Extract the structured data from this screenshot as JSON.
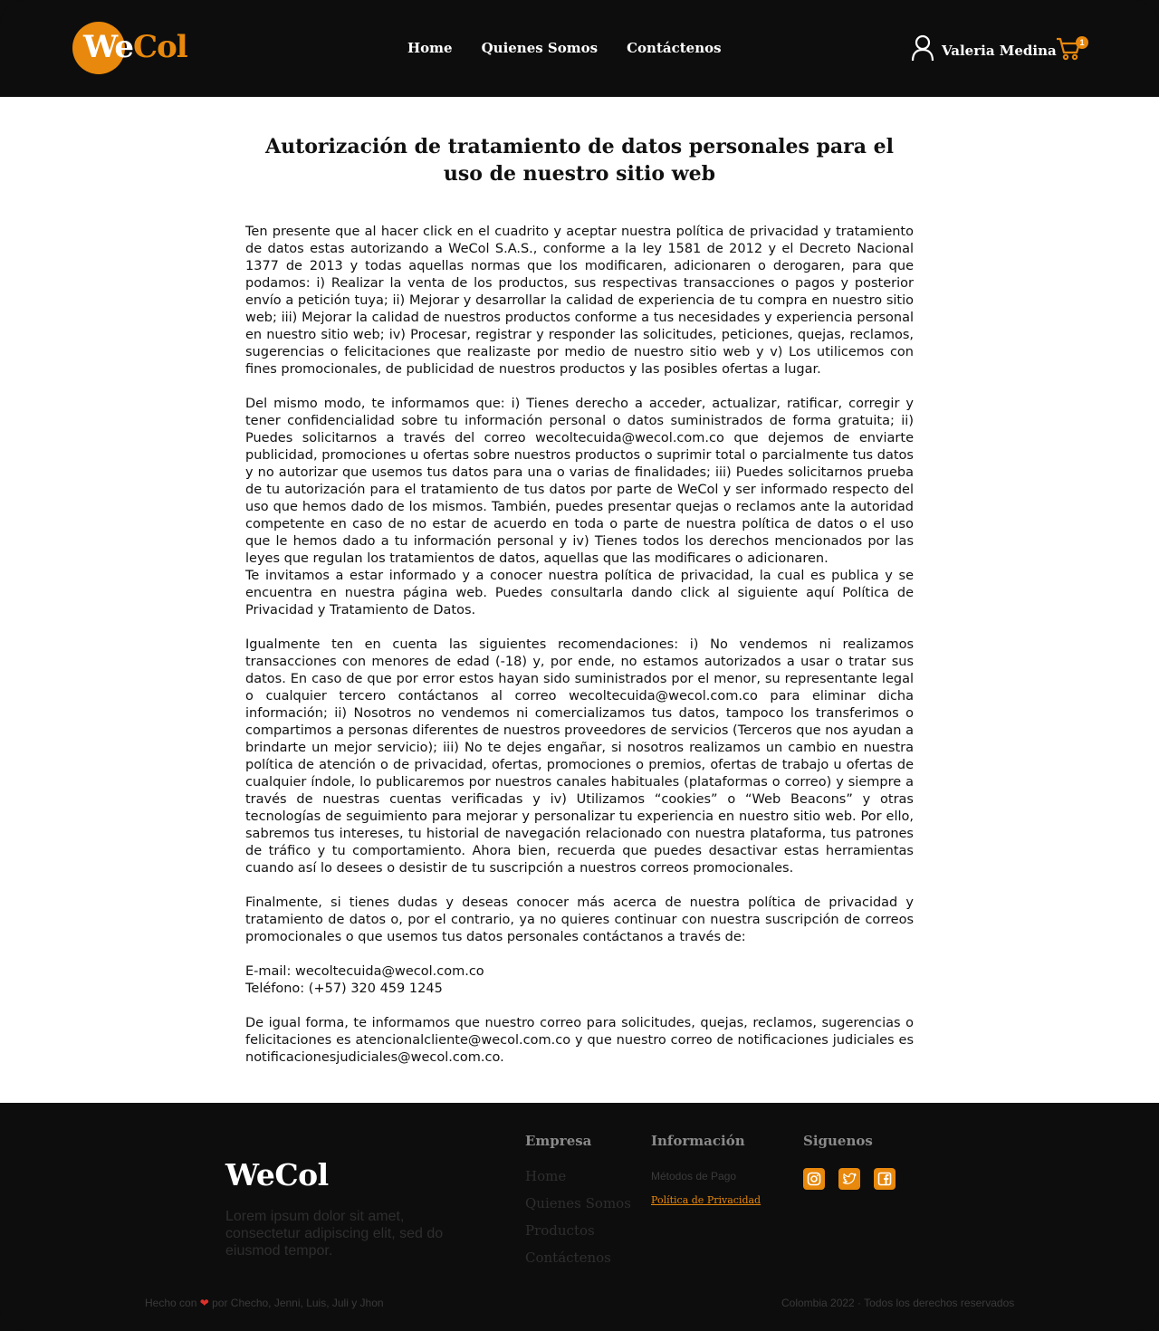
{
  "brand": {
    "logo_we": "We",
    "logo_col": "Col",
    "accent_color": "#e8880c"
  },
  "nav": {
    "items": [
      "Home",
      "Quienes Somos",
      "Contáctenos"
    ]
  },
  "user": {
    "name": "Valeria Medina",
    "user_icon": "user-icon",
    "cart_icon": "cart-icon",
    "cart_count": "1"
  },
  "main": {
    "title": "Autorización de tratamiento de datos personales para el uso de nuestro sitio web",
    "p1": "Ten presente que al hacer click en el cuadrito y aceptar nuestra política de privacidad y tratamiento de datos estas autorizando a WeCol S.A.S., conforme a la ley 1581 de 2012 y el Decreto Nacional 1377 de 2013 y todas aquellas normas que los modificaren, adicionaren o derogaren, para que podamos: i) Realizar la venta de los productos, sus respectivas transacciones o pagos y posterior envío a petición tuya; ii) Mejorar y desarrollar la calidad de experiencia de tu compra en nuestro sitio web; iii) Mejorar la calidad de nuestros productos conforme a tus necesidades y experiencia personal en nuestro sitio web; iv) Procesar, registrar y responder las solicitudes, peticiones, quejas, reclamos, sugerencias o felicitaciones que realizaste por medio de nuestro sitio web y v) Los utilicemos con fines promocionales, de publicidad de nuestros productos y las posibles ofertas a lugar.",
    "p2": "Del mismo modo, te informamos que: i) Tienes derecho a acceder, actualizar, ratificar, corregir y tener confidencialidad sobre tu información personal o datos suministrados de forma gratuita; ii) Puedes solicitarnos a través del correo wecoltecuida@wecol.com.co que dejemos de enviarte publicidad, promociones u ofertas sobre nuestros productos o suprimir total o parcialmente tus datos y no autorizar que usemos tus datos para una o varias de finalidades; iii) Puedes solicitarnos prueba de tu autorización para el tratamiento de tus datos por parte de WeCol y ser informado respecto del uso que hemos dado de los mismos. También, puedes presentar quejas o reclamos ante la autoridad competente en caso de no estar de acuerdo en toda o parte de nuestra política de datos o el uso que le hemos dado a tu información personal y iv) Tienes todos los derechos mencionados por las leyes que regulan los tratamientos de datos, aquellas que las modificares o adicionaren.",
    "p3": "Te invitamos a estar informado y a conocer nuestra política de privacidad, la cual es publica y se encuentra en nuestra página web. Puedes consultarla dando click al siguiente aquí Política de Privacidad y Tratamiento de Datos.",
    "p4": "Igualmente ten en cuenta las siguientes recomendaciones: i) No vendemos ni realizamos transacciones con menores de edad (-18) y, por ende, no estamos autorizados a usar o tratar sus datos. En caso de que por error estos hayan sido suministrados por el menor, su representante legal o cualquier tercero contáctanos al correo wecoltecuida@wecol.com.co para eliminar dicha información; ii) Nosotros no vendemos ni comercializamos tus datos, tampoco los transferimos o compartimos a personas diferentes de nuestros proveedores de servicios (Terceros que nos ayudan a brindarte un mejor servicio); iii) No te dejes engañar, si nosotros realizamos un cambio en nuestra política de atención o de privacidad, ofertas, promociones o premios, ofertas de trabajo u ofertas de cualquier índole, lo publicaremos por nuestros canales habituales (plataformas o correo) y siempre a través de nuestras cuentas verificadas y iv) Utilizamos “cookies” o “Web Beacons” y otras tecnologías de seguimiento para mejorar y personalizar tu experiencia en nuestro sitio web. Por ello, sabremos tus intereses, tu historial de navegación relacionado con nuestra plataforma, tus patrones de tráfico y tu comportamiento. Ahora bien, recuerda que puedes desactivar estas herramientas cuando así lo desees o desistir de tu suscripción a nuestros correos promocionales.",
    "p5": "Finalmente, si tienes dudas y deseas conocer más acerca de nuestra política de privacidad y tratamiento de datos o, por el contrario, ya no quieres continuar con nuestra suscripción de correos promocionales o que usemos tus datos personales contáctanos a través de:",
    "email_line": "E-mail: wecoltecuida@wecol.com.co",
    "phone_line": "Teléfono: (+57) 320 459 1245",
    "p6": "De igual forma, te informamos que nuestro correo para solicitudes, quejas, reclamos, sugerencias o felicitaciones es atencionalcliente@wecol.com.co y que nuestro correo de notificaciones judiciales es notificacionesjudiciales@wecol.com.co."
  },
  "footer": {
    "logo": "WeCol",
    "description": "Lorem ipsum dolor sit amet, consectetur adipiscing elit, sed do eiusmod tempor.",
    "empresa": {
      "title": "Empresa",
      "links": [
        "Home",
        "Quienes Somos",
        "Productos",
        "Contáctenos"
      ]
    },
    "informacion": {
      "title": "Información",
      "links": [
        "Métodos de Pago",
        "Política de Privacidad"
      ]
    },
    "siguenos": {
      "title": "Siguenos",
      "icons": [
        "instagram-icon",
        "twitter-icon",
        "facebook-icon"
      ]
    },
    "credit_prefix": "Hecho con",
    "credit_suffix": "por Checho, Jenni, Luis, Juli y Jhon",
    "copyright": "Colombia 2022 · Todos los derechos reservados"
  }
}
